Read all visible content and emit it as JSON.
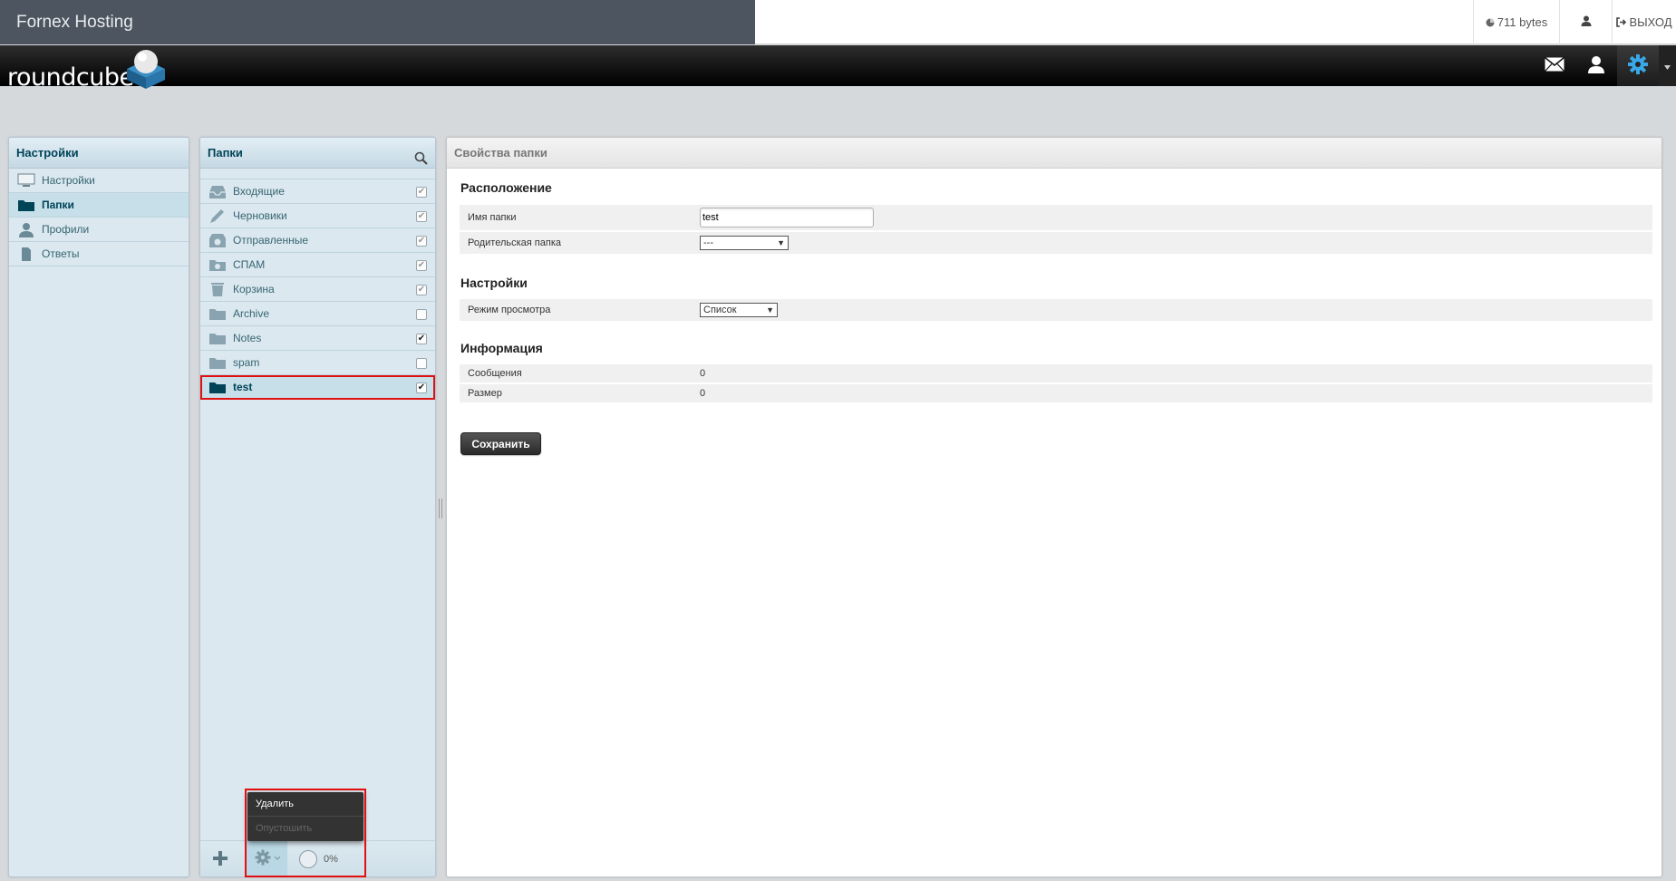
{
  "fornex": {
    "brand": "Fornex Hosting",
    "quota": "711 bytes",
    "logout": "ВЫХОД"
  },
  "rc": {
    "logo": "roundcube",
    "toolbar": {
      "mail_icon": "envelope-icon",
      "contacts_icon": "user-icon",
      "settings_icon": "gear-icon"
    }
  },
  "settings_panel": {
    "title": "Настройки",
    "items": [
      {
        "label": "Настройки",
        "icon": "monitor-icon",
        "selected": false
      },
      {
        "label": "Папки",
        "icon": "folder-icon",
        "selected": true
      },
      {
        "label": "Профили",
        "icon": "person-icon",
        "selected": false
      },
      {
        "label": "Ответы",
        "icon": "document-icon",
        "selected": false
      }
    ]
  },
  "folders_panel": {
    "title": "Папки",
    "folders": [
      {
        "label": "Входящие",
        "icon": "inbox-icon",
        "subscribed": true,
        "locked": true
      },
      {
        "label": "Черновики",
        "icon": "pencil-icon",
        "subscribed": true,
        "locked": true
      },
      {
        "label": "Отправленные",
        "icon": "sent-icon",
        "subscribed": true,
        "locked": true
      },
      {
        "label": "СПАМ",
        "icon": "junk-icon",
        "subscribed": true,
        "locked": true
      },
      {
        "label": "Корзина",
        "icon": "trash-icon",
        "subscribed": true,
        "locked": true
      },
      {
        "label": "Archive",
        "icon": "folder-icon",
        "subscribed": false,
        "locked": false
      },
      {
        "label": "Notes",
        "icon": "folder-icon",
        "subscribed": true,
        "locked": false
      },
      {
        "label": "spam",
        "icon": "folder-icon",
        "subscribed": false,
        "locked": false
      },
      {
        "label": "test",
        "icon": "folder-icon",
        "subscribed": true,
        "locked": false,
        "selected": true
      }
    ],
    "quota": "0%",
    "menu": {
      "delete": "Удалить",
      "empty": "Опустошить"
    }
  },
  "props": {
    "title": "Свойства папки",
    "location": {
      "title": "Расположение",
      "name_label": "Имя папки",
      "name_value": "test",
      "parent_label": "Родительская папка",
      "parent_value": "---"
    },
    "settings": {
      "title": "Настройки",
      "view_mode_label": "Режим просмотра",
      "view_mode_value": "Список"
    },
    "info": {
      "title": "Информация",
      "messages_label": "Сообщения",
      "messages_value": "0",
      "size_label": "Размер",
      "size_value": "0"
    },
    "save_label": "Сохранить"
  }
}
